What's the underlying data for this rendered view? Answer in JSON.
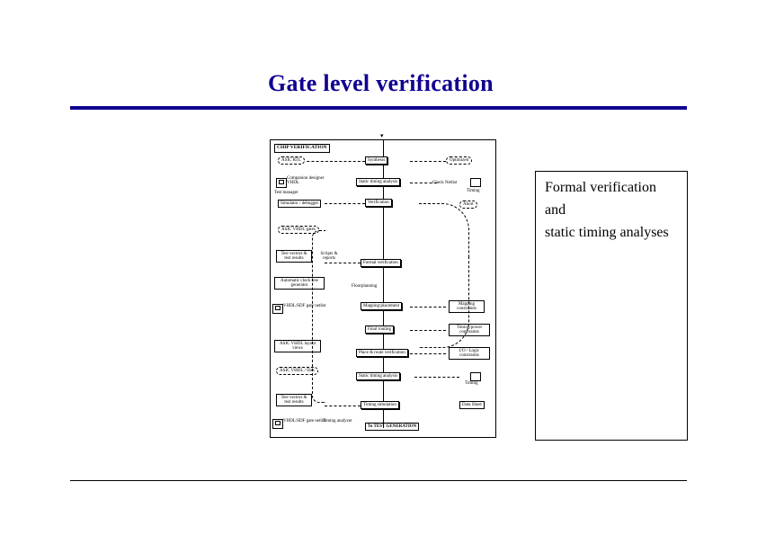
{
  "title": "Gate level verification",
  "diagram": {
    "title": "CHIP VERIFICATION",
    "central": {
      "synthesis": "Synthesis",
      "sta1": "Static timing analysis",
      "verification": "Verification",
      "formal": "Formal verification",
      "floorplan": "Floorplanning",
      "mapping": "Mapping/placement",
      "routing": "Final routing",
      "place_route": "Place & route verification",
      "sta2": "Static timing analysis",
      "timing_sim": "Timing simulation",
      "to_test": "To TEST GENERATION"
    },
    "left": {
      "rtl": "ASIC RTL",
      "designer": "Companion designer VHDL",
      "test_mgr": "Test manager",
      "simulator": "Simulator / debugger",
      "gates": "ASIC VHDL gates",
      "test_vec": "Test vectors & test results",
      "scripts": "Scripts & reports",
      "clk_tree": "Automatic clock tree generator",
      "vhdl_editor": "VHDL/SDF gate netlist",
      "layout": "ASIC VHDL layout views",
      "parasitic": "ASIC VHDL / files",
      "test_vec2": "Test vectors & test results",
      "analyzer": "Timing analyzer",
      "pc_label": "VHDL/SDF gate netlist"
    },
    "right": {
      "optimized": "Optimized",
      "check_netlist": "Check Netlist",
      "timing1": "Timing",
      "abort": "Abort",
      "mapping_constr": "Mapping constraints",
      "timing_constr": "Timing/power constraints",
      "io_constr": "I/O / Logic constraints",
      "timing2": "Timing",
      "datasheet": "Data Sheet"
    }
  },
  "side": {
    "p1": "Formal verification",
    "p2": "and",
    "p3": "static timing analyses"
  }
}
